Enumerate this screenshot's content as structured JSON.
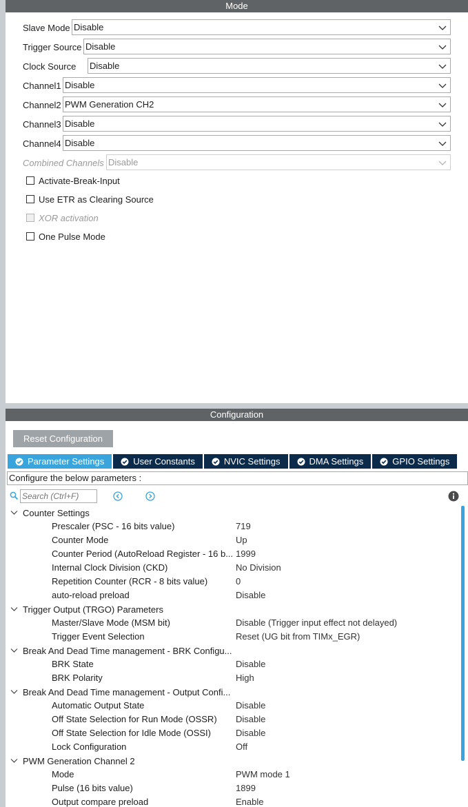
{
  "mode": {
    "header": "Mode",
    "fields": [
      {
        "label": "Slave Mode",
        "value": "Disable"
      },
      {
        "label": "Trigger Source",
        "value": "Disable"
      },
      {
        "label": "Clock Source",
        "value": "Disable"
      },
      {
        "label": "Channel1",
        "value": "Disable"
      },
      {
        "label": "Channel2",
        "value": "PWM Generation CH2"
      },
      {
        "label": "Channel3",
        "value": "Disable"
      },
      {
        "label": "Channel4",
        "value": "Disable"
      },
      {
        "label": "Combined Channels",
        "value": "Disable"
      }
    ],
    "checkboxes": [
      {
        "label": "Activate-Break-Input"
      },
      {
        "label": "Use ETR as Clearing Source"
      },
      {
        "label": "XOR activation"
      },
      {
        "label": "One Pulse Mode"
      }
    ]
  },
  "config": {
    "header": "Configuration",
    "reset_label": "Reset Configuration",
    "tabs": [
      {
        "label": "Parameter Settings"
      },
      {
        "label": "User Constants"
      },
      {
        "label": "NVIC Settings"
      },
      {
        "label": "DMA Settings"
      },
      {
        "label": "GPIO Settings"
      }
    ],
    "description": "Configure the below parameters :",
    "search_placeholder": "Search (Ctrl+F)",
    "groups": [
      {
        "title": "Counter Settings",
        "params": [
          {
            "name": "Prescaler (PSC - 16 bits value)",
            "value": "719"
          },
          {
            "name": "Counter Mode",
            "value": "Up"
          },
          {
            "name": "Counter Period (AutoReload Register - 16 b...",
            "value": "1999"
          },
          {
            "name": "Internal Clock Division (CKD)",
            "value": "No Division"
          },
          {
            "name": "Repetition Counter (RCR - 8 bits value)",
            "value": "0"
          },
          {
            "name": "auto-reload preload",
            "value": "Disable"
          }
        ]
      },
      {
        "title": "Trigger Output (TRGO) Parameters",
        "params": [
          {
            "name": "Master/Slave Mode (MSM bit)",
            "value": "Disable (Trigger input effect not delayed)"
          },
          {
            "name": "Trigger Event Selection",
            "value": "Reset (UG bit from TIMx_EGR)"
          }
        ]
      },
      {
        "title": "Break And Dead Time management - BRK Configu...",
        "params": [
          {
            "name": "BRK State",
            "value": "Disable"
          },
          {
            "name": "BRK Polarity",
            "value": "High"
          }
        ]
      },
      {
        "title": "Break And Dead Time management - Output Confi...",
        "params": [
          {
            "name": "Automatic Output State",
            "value": "Disable"
          },
          {
            "name": "Off State Selection for Run Mode (OSSR)",
            "value": "Disable"
          },
          {
            "name": "Off State Selection for Idle Mode (OSSI)",
            "value": "Disable"
          },
          {
            "name": "Lock Configuration",
            "value": "Off"
          }
        ]
      },
      {
        "title": "PWM Generation Channel 2",
        "params": [
          {
            "name": "Mode",
            "value": "PWM mode 1"
          },
          {
            "name": "Pulse (16 bits value)",
            "value": "1899"
          },
          {
            "name": "Output compare preload",
            "value": "Enable"
          }
        ]
      }
    ]
  },
  "colors": {
    "header_bg": "#5f6366",
    "tab_active": "#39a5dc",
    "tab_inactive": "#0c2a4a",
    "scrollbar": "#39a5dc"
  },
  "icons": [
    "chevron-down-icon",
    "check-circle-icon",
    "search-icon",
    "prev-icon",
    "next-icon",
    "info-icon",
    "tree-collapse-icon"
  ]
}
